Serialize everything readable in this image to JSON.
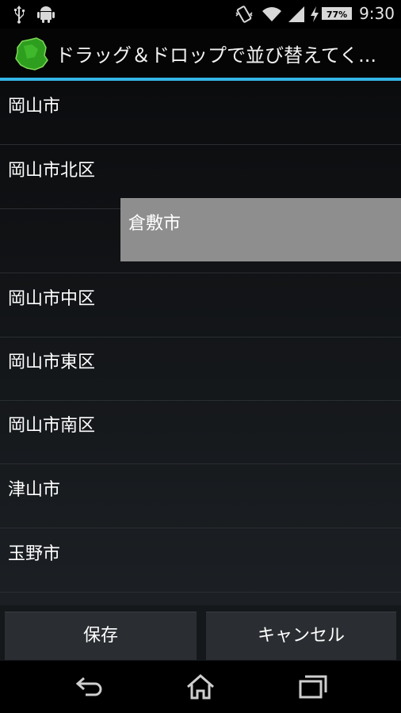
{
  "status_bar": {
    "time": "9:30",
    "battery_percent": "77%",
    "icons": [
      "usb-icon",
      "android-icon",
      "vibrate-icon",
      "wifi-icon",
      "signal-icon",
      "charging-icon",
      "battery-icon"
    ]
  },
  "action_bar": {
    "app_icon": "okayama-map-icon",
    "title": "ドラッグ＆ドロップで並び替えてく..."
  },
  "list": {
    "items": [
      {
        "label": "岡山市"
      },
      {
        "label": "岡山市北区"
      },
      {
        "label": ""
      },
      {
        "label": "岡山市中区"
      },
      {
        "label": "岡山市東区"
      },
      {
        "label": "岡山市南区"
      },
      {
        "label": "津山市"
      },
      {
        "label": "玉野市"
      }
    ],
    "dragging_item": {
      "label": "倉敷市"
    }
  },
  "buttons": {
    "save": "保存",
    "cancel": "キャンセル"
  },
  "nav_bar": {
    "icons": [
      "back-icon",
      "home-icon",
      "recent-apps-icon"
    ]
  },
  "colors": {
    "accent": "#33b5e5",
    "drag_background": "#8e8e8e",
    "app_icon_green": "#2e9e1f"
  }
}
